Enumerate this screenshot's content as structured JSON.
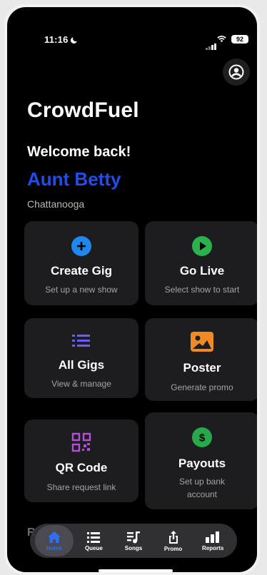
{
  "status": {
    "time": "11:16",
    "battery": "92"
  },
  "header": {
    "app_title": "CrowdFuel",
    "welcome": "Welcome back!",
    "user_name": "Aunt Betty",
    "city": "Chattanooga"
  },
  "cards": [
    {
      "title": "Create Gig",
      "subtitle": "Set up a new show",
      "icon": "plus-circle-icon",
      "color": "#1e88f0"
    },
    {
      "title": "Go Live",
      "subtitle": "Select show to start",
      "icon": "play-circle-icon",
      "color": "#2bb24c"
    },
    {
      "title": "All Gigs",
      "subtitle": "View & manage",
      "icon": "list-icon",
      "color": "#6b5cff"
    },
    {
      "title": "Poster",
      "subtitle": "Generate promo",
      "icon": "image-icon",
      "color": "#f08a24"
    },
    {
      "title": "QR Code",
      "subtitle": "Share request link",
      "icon": "qr-code-icon",
      "color": "#b44ee0"
    },
    {
      "title": "Payouts",
      "subtitle": "Set up bank account",
      "icon": "dollar-circle-icon",
      "color": "#27a84a"
    }
  ],
  "peek_text": "R",
  "tabs": [
    {
      "label": "Home",
      "icon": "home-icon",
      "active": true
    },
    {
      "label": "Queue",
      "icon": "queue-icon"
    },
    {
      "label": "Songs",
      "icon": "music-note-icon"
    },
    {
      "label": "Promo",
      "icon": "share-icon"
    },
    {
      "label": "Reports",
      "icon": "bar-chart-icon"
    }
  ],
  "accent": "#2f6ef5"
}
